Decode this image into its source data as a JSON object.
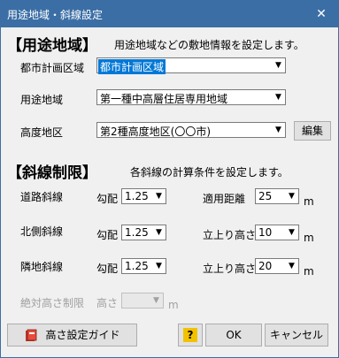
{
  "window": {
    "title": "用途地域・斜線設定",
    "close": "✕"
  },
  "zoning": {
    "heading": "【用途地域】",
    "description": "用途地域などの敷地情報を設定します。",
    "city_area_label": "都市計画区域",
    "city_area_value": "都市計画区域",
    "use_district_label": "用途地域",
    "use_district_value": "第一種中高層住居専用地域",
    "height_district_label": "高度地区",
    "height_district_value": "第2種高度地区(〇〇市)",
    "edit_button": "編集"
  },
  "slant": {
    "heading": "【斜線制限】",
    "description": "各斜線の計算条件を設定します。",
    "slope_label": "勾配",
    "meter_unit": "m",
    "rows": [
      {
        "label": "道路斜線",
        "slope": "1.25",
        "param_label": "適用距離",
        "param_value": "25"
      },
      {
        "label": "北側斜線",
        "slope": "1.25",
        "param_label": "立上り高さ",
        "param_value": "10"
      },
      {
        "label": "隣地斜線",
        "slope": "1.25",
        "param_label": "立上り高さ",
        "param_value": "20"
      }
    ],
    "absolute_label": "絶対高さ制限",
    "absolute_height_label": "高さ",
    "absolute_unit": "m"
  },
  "footer": {
    "guide_button": "高さ設定ガイド",
    "help_icon": "?",
    "ok_button": "OK",
    "cancel_button": "キャンセル"
  }
}
